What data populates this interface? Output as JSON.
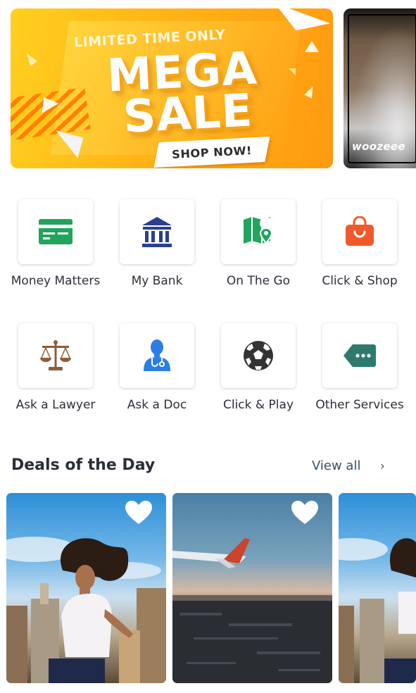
{
  "banners": {
    "main": {
      "limited_text": "LIMITED TIME ONLY",
      "mega_text": "MEGA",
      "sale_text": "SALE",
      "shop_now_label": "SHOP NOW!"
    },
    "secondary": {
      "brand_text": "woozeee"
    }
  },
  "services": [
    {
      "label": "Money Matters",
      "icon": "credit-card-icon",
      "color": "#22a45d"
    },
    {
      "label": "My Bank",
      "icon": "bank-icon",
      "color": "#2a3f8f"
    },
    {
      "label": "On The Go",
      "icon": "map-pin-icon",
      "color": "#22a45d"
    },
    {
      "label": "Click & Shop",
      "icon": "shopping-bag-icon",
      "color": "#f05a2a"
    },
    {
      "label": "Ask a Lawyer",
      "icon": "scales-icon",
      "color": "#8d5e3c"
    },
    {
      "label": "Ask a Doc",
      "icon": "doctor-icon",
      "color": "#2c7fe0"
    },
    {
      "label": "Click & Play",
      "icon": "soccer-ball-icon",
      "color": "#333333"
    },
    {
      "label": "Other Services",
      "icon": "more-tag-icon",
      "color": "#2f7a6f"
    }
  ],
  "deals": {
    "title": "Deals of the Day",
    "view_all_label": "View all",
    "chevron": "›"
  }
}
